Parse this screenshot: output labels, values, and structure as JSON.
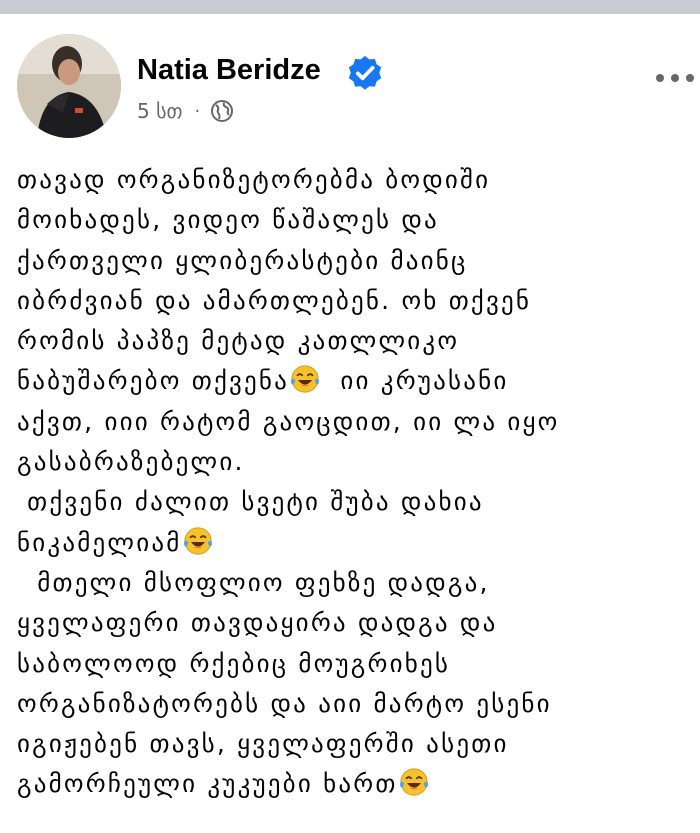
{
  "post": {
    "author": "Natia Beridze",
    "time": "5 სთ",
    "separator": "·",
    "audience_icon": "globe-icon",
    "verified_icon": "verified-badge-icon",
    "menu_icon": "more-options-icon",
    "colors": {
      "verified": "#1877f2",
      "text": "#050505",
      "meta": "#65676b",
      "top_bar": "#c9ccd1"
    },
    "body_lines": [
      {
        "text": "თავად ორგანიზეტორებმა ბოდიში",
        "emoji": ""
      },
      {
        "text": "მოიხადეს, ვიდეო წაშალეს და",
        "emoji": ""
      },
      {
        "text": "ქართველი ყლიბერასტები მაინც",
        "emoji": ""
      },
      {
        "text": "იბრძვიან და ამართლებენ. ოხ თქვენ",
        "emoji": ""
      },
      {
        "text": "რომის პაპზე მეტად კათლლიკო",
        "emoji": ""
      },
      {
        "text": "ნაბუშარებო თქვენა",
        "emoji": "😂"
      },
      {
        "text": "აქვთ, იიი რატომ გაოცდით, იი ლა იყო",
        "emoji": ""
      },
      {
        "text": "გასაბრაზებელი.",
        "emoji": ""
      },
      {
        "text": " თქვენი ძალით სვეტი შუბა დახია",
        "emoji": ""
      },
      {
        "text": "ნიკამელიამ",
        "emoji": "😂"
      },
      {
        "text": "  მთელი მსოფლიო ფეხზე დადგა,",
        "emoji": ""
      },
      {
        "text": "ყველაფერი თავდაყირა დადგა და",
        "emoji": ""
      },
      {
        "text": "საბოლოოდ რქებიც მოუგრიხეს",
        "emoji": ""
      },
      {
        "text": "ორგანიზატორებს და აიი მარტო ესენი",
        "emoji": ""
      },
      {
        "text": "იგიჟებენ თავს, ყველაფერში ასეთი",
        "emoji": ""
      },
      {
        "text": "გამორჩეული კუკუები ხართ",
        "emoji": "😂"
      }
    ],
    "line6_tail": "  იი კრუასანი"
  }
}
